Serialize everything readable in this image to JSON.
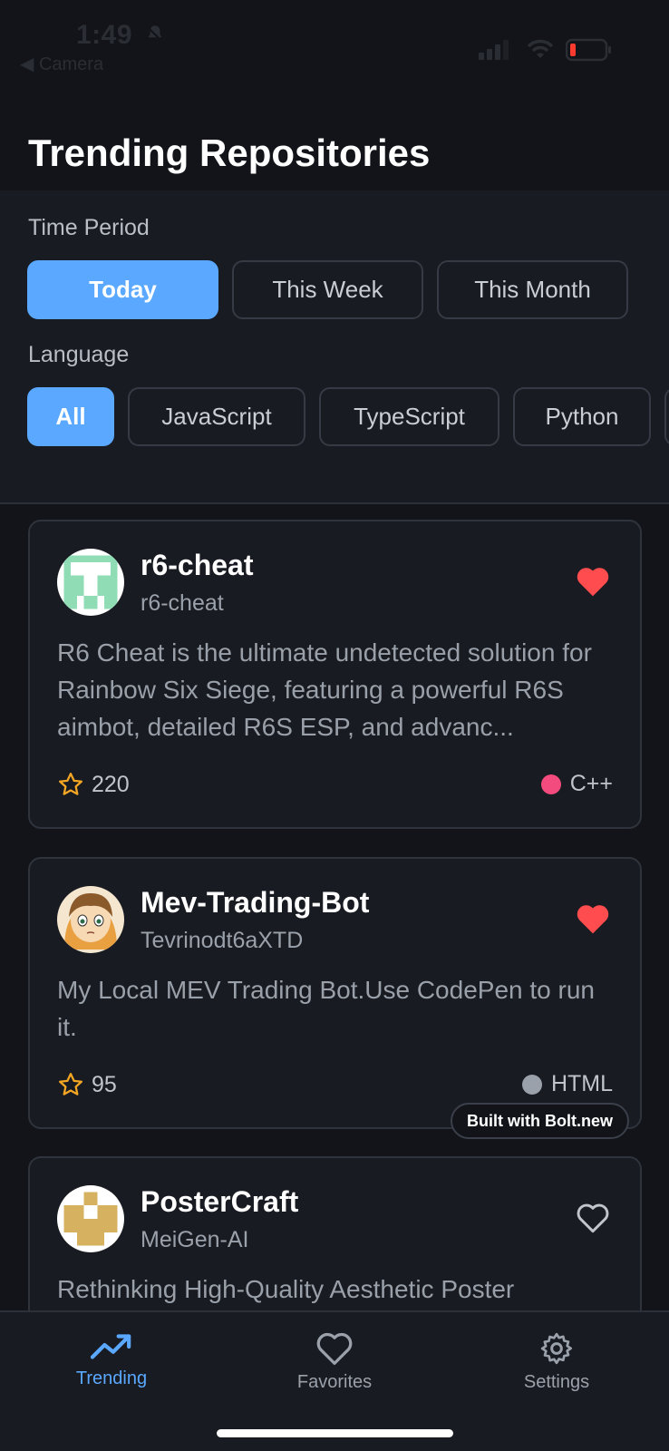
{
  "status": {
    "time": "1:49",
    "back_label": "◀ Camera"
  },
  "header": {
    "title": "Trending Repositories"
  },
  "filters": {
    "time_label": "Time Period",
    "time_options": [
      "Today",
      "This Week",
      "This Month"
    ],
    "time_selected": "Today",
    "language_label": "Language",
    "language_options": [
      "All",
      "JavaScript",
      "TypeScript",
      "Python"
    ],
    "language_selected": "All"
  },
  "repos": [
    {
      "name": "r6-cheat",
      "owner": "r6-cheat",
      "description": "R6 Cheat is the ultimate undetected solution for Rainbow Six Siege, featuring a powerful R6S aimbot, detailed R6S ESP, and advanc...",
      "stars": "220",
      "language": "C++",
      "language_color": "#f34b7d",
      "favorited": true
    },
    {
      "name": "Mev-Trading-Bot",
      "owner": "Tevrinodt6aXTD",
      "description": "My Local MEV Trading Bot.Use CodePen to run it.",
      "stars": "95",
      "language": "HTML",
      "language_color": "#9ba1ab",
      "favorited": true
    },
    {
      "name": "PosterCraft",
      "owner": "MeiGen-AI",
      "description": "Rethinking High-Quality Aesthetic Poster",
      "favorited": false
    }
  ],
  "badge": {
    "label": "Built with Bolt.new"
  },
  "tabbar": {
    "tabs": [
      {
        "label": "Trending",
        "icon": "trending-icon"
      },
      {
        "label": "Favorites",
        "icon": "heart-icon"
      },
      {
        "label": "Settings",
        "icon": "gear-icon"
      }
    ],
    "active": "Trending"
  },
  "colors": {
    "accent": "#5aa8ff",
    "favorite": "#ff4d4f",
    "star": "#f5a623"
  }
}
